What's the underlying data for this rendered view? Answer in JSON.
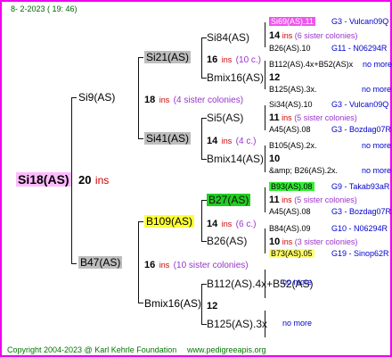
{
  "header": {
    "date": "8- 2-2023 ( 19: 46)"
  },
  "footer": {
    "copyright": "Copyright 2004-2023 @ Karl Kehrle Foundation",
    "site": "www.pedigreeapis.org"
  },
  "root": {
    "name": "Si18(AS)",
    "count": "20",
    "ins": "ins"
  },
  "level1": [
    {
      "name": "Si9(AS)",
      "count": "18",
      "ins": "ins",
      "sisters": "(4 sister colonies)"
    },
    {
      "name": "B47(AS)",
      "count": "16",
      "ins": "ins",
      "sisters": "(10 sister colonies)"
    }
  ],
  "level2": [
    {
      "name": "Si21(AS)",
      "count": "16",
      "ins": "ins",
      "sisters": "(10 c.)"
    },
    {
      "name": "Si41(AS)",
      "count": "14",
      "ins": "ins",
      "sisters": "(4 c.)"
    },
    {
      "name": "B109(AS)",
      "count": "14",
      "ins": "ins",
      "sisters": "(6 c.)"
    },
    {
      "name": "Bmix16(AS)",
      "count": "12",
      "ins": "",
      "sisters": ""
    }
  ],
  "level3": [
    {
      "name": "Si84(AS)"
    },
    {
      "name": "Bmix16(AS)"
    },
    {
      "name": "Si5(AS)"
    },
    {
      "name": "Bmix14(AS)"
    },
    {
      "name": "B27(AS)"
    },
    {
      "name": "B26(AS)"
    },
    {
      "name": "B112(AS).4x+B52(AS)"
    },
    {
      "name": "B125(AS).3x"
    }
  ],
  "level4": [
    {
      "name": "Si69(AS).11",
      "link": "G3 - Vulcan09Q",
      "count": "14",
      "ins": "ins",
      "sisters": "(6 sister colonies)"
    },
    {
      "name": "B26(AS).10",
      "link": "G11 - N06294R"
    },
    {
      "name": "B112(AS).4x+B52(AS)x",
      "link": "no more"
    },
    {
      "name": "12",
      "link": ""
    },
    {
      "name": "B125(AS).3x.",
      "link": "no more"
    },
    {
      "name": "Si34(AS).10",
      "link": "G3 - Vulcan09Q",
      "count": "11",
      "ins": "ins",
      "sisters": "(5 sister colonies)"
    },
    {
      "name": "A45(AS).08",
      "link": "G3 - Bozdag07R"
    },
    {
      "name": "B105(AS).2x.",
      "link": "no more"
    },
    {
      "name": "10",
      "link": ""
    },
    {
      "name": "&amp; B26(AS).2x.",
      "link": "no more"
    },
    {
      "name": "B93(AS).08",
      "link": "G9 - Takab93aR",
      "count": "11",
      "ins": "ins",
      "sisters": "(5 sister colonies)"
    },
    {
      "name": "A45(AS).08",
      "link": "G3 - Bozdag07R"
    },
    {
      "name": "B84(AS).09",
      "link": "G10 - N06294R",
      "count": "10",
      "ins": "ins",
      "sisters": "(3 sister colonies)"
    },
    {
      "name": "B73(AS).05",
      "link": "G19 - Sinop62R"
    },
    {
      "name": "no more",
      "link": ""
    },
    {
      "name": "no more",
      "link": ""
    }
  ]
}
